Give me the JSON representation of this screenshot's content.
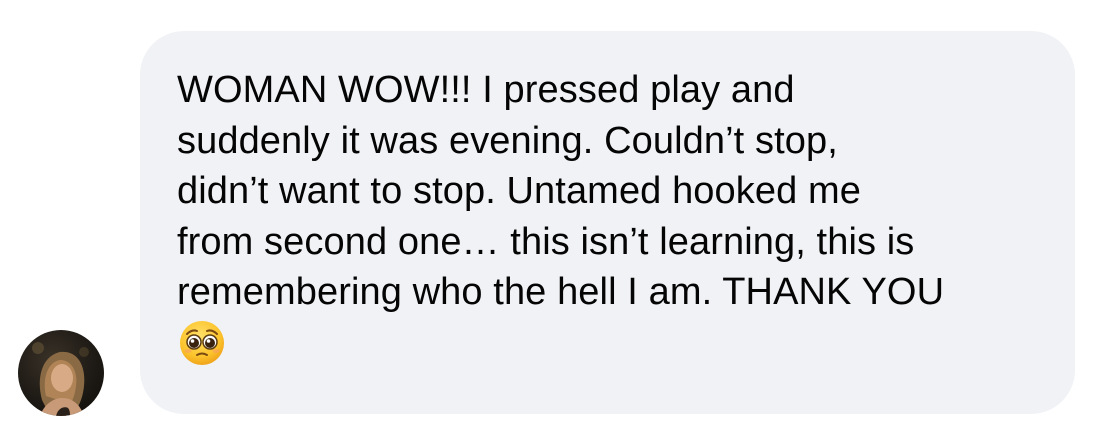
{
  "comment": {
    "author_avatar_icon": "profile-photo",
    "message_text": "WOMAN WOW!!! I pressed play and\nsuddenly it was evening. Couldn’t stop,\ndidn’t want to stop. Untamed hooked me\nfrom second one… this isn’t learning, this is\nremembering who the hell I am. THANK YOU",
    "emoji_icon": "pleading-face-emoji",
    "bubble_color": "#f0f2f5",
    "text_color": "#050505"
  }
}
